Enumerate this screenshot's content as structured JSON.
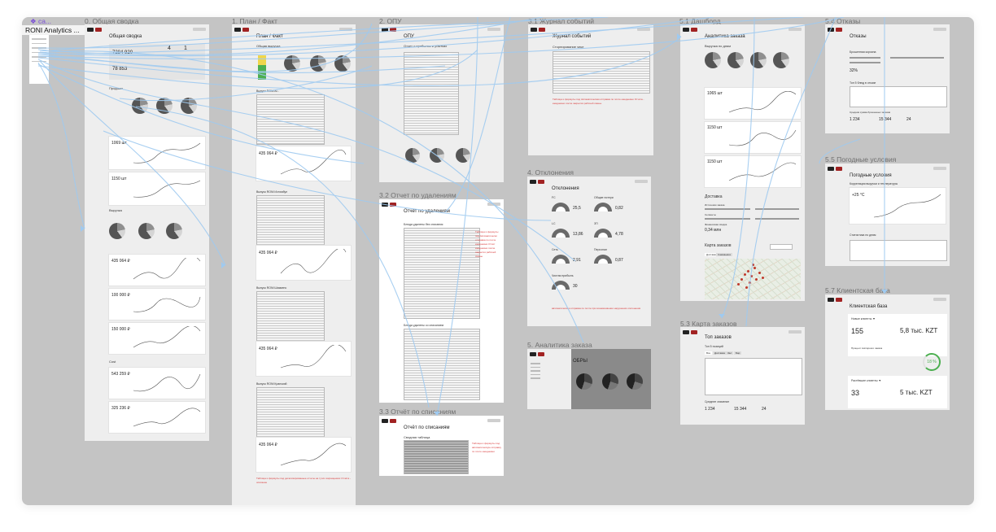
{
  "colors": {
    "canvas": "#c4c4c4",
    "accent_purple": "#7b4fd6",
    "connector_blue": "#9fcaf0",
    "note_red": "#d83a3a",
    "positive_green": "#4caf50",
    "brand_red": "#a12222"
  },
  "page": {
    "badge": "❖ ca...",
    "badge_icon": "component-icon",
    "tab_title": "RONI Analytics ...",
    "tab_icon": "play-icon"
  },
  "frames": {
    "svodka": {
      "label": "0. Общая сводка",
      "title": "Общая сводка",
      "kpi_main": "7284 920",
      "kpi_b": "4",
      "kpi_c": "1",
      "kpi_d": "78 853",
      "sections": [
        "Продажи",
        "Выручка",
        "Cost"
      ],
      "values": [
        "1069 шт",
        "1150 шт",
        "435 064 ₽",
        "100 000 ₽",
        "150 000 ₽",
        "543 259 ₽",
        "325 236 ₽"
      ]
    },
    "planfact": {
      "label": "1. План / Факт",
      "title": "План / Факт",
      "section": "Общая выручка",
      "blocks": [
        "Выпуск RONI Al...",
        "Выпуск RONI Истомбул",
        "Выпуск RONI Шимкенс",
        "Выпуск RONI Кранский"
      ],
      "values": [
        "435 064 ₽",
        "435 064 ₽",
        "435 064 ₽",
        "435 064 ₽"
      ],
      "note": "Таблица и формулы под детализированные отчеты на тугих сокращениях Отчёта - описание"
    },
    "opu": {
      "label": "2. ОПУ",
      "title": "ОПУ",
      "section": "Отчет о прибылях и убытках"
    },
    "udaleniya": {
      "label": "3.2 Отчет по удалениям",
      "title": "Отчет по удалениям",
      "s1": "Блюда удалены без списания",
      "s2": "Блюда удалены со списанием",
      "note": "Таблица и формулы под Автоматически отправка по почте ежедневно Отчёт ежедневно после закрытия рабочей смены"
    },
    "spisaniya": {
      "label": "3.3 Отчёт по списаниям",
      "title": "Отчёт по списаниям",
      "section": "Сводная таблица",
      "note": "Таблица и формулы под автоматическую отправку по почте ежедневно"
    },
    "zhurnal": {
      "label": "3.1 Журнал событий",
      "title": "Журнал событий",
      "section": "Сторнирование чеке",
      "note": "Таблица и формулы под Автоматическая отправка по почте ежедневно Отчёта - ежедневно после закрытия рабочей смены"
    },
    "otkloneniya": {
      "label": "4. Отклонения",
      "title": "Отклонения",
      "gauges": [
        {
          "label": "FC",
          "value": "25,5"
        },
        {
          "label": "Общие потери",
          "value": "0,82"
        },
        {
          "label": "LC",
          "value": "13,86"
        },
        {
          "label": "ЗП",
          "value": "4,78"
        },
        {
          "label": "Сеть",
          "value": "2,91"
        },
        {
          "label": "Персонал",
          "value": "0,87"
        },
        {
          "label": "Чистая прибыль",
          "value": "30"
        }
      ],
      "note": "автоматическая отправка по почте при возникновении нарушения отклонения"
    },
    "analitika": {
      "label": "5. Аналитика заказа",
      "title": "ОБРЫ"
    },
    "dashbord": {
      "label": "5.1 Дашборд",
      "title": "Аналитика заказа",
      "section": "Выручка по дням",
      "values": [
        "1065 шт",
        "1150 шт",
        "1150 шт"
      ],
      "delivery_title": "Доставка",
      "delivery_fields": [
        "Источники заказа",
        "Сегменты",
        "Финансовая сводка"
      ],
      "delivery_value": "0,34 млн",
      "map_title": "Карта заказов",
      "map_tabs": [
        "Доставка",
        "Самовывоз"
      ]
    },
    "karta": {
      "label": "5.3 Карта заказов",
      "title": "Топ заказов",
      "section": "Топ 5 позиций",
      "tabs": [
        "Все",
        "Доставка",
        "Зал",
        "Бар"
      ],
      "avg_label": "Среднее значение",
      "avg": [
        "1 234",
        "15 344",
        "24"
      ]
    },
    "otkazy": {
      "label": "5.4 Отказы",
      "title": "Отказы",
      "section": "Брошенная корзина",
      "value": "32%",
      "top5": "Топ 5 блюд в отказе",
      "avg_label": "Средняя сумма брошенных заказов",
      "avg": [
        "1 234",
        "15 344",
        "24"
      ]
    },
    "pogoda": {
      "label": "5.5 Погодные условия",
      "title": "Погодные условия",
      "section": "Корреляция выручки и температуры",
      "temp": "+25 °C",
      "stats": "Статистика по дням"
    },
    "klient": {
      "label": "5.7 Клиентская база",
      "title": "Клиентская база",
      "new_title": "Новые клиенты ▼",
      "new_count": "155",
      "new_sum": "5,8 тыс. KZT",
      "pct_title": "Процент повторного заказа",
      "pct": "18 %",
      "lost_title": "Растёвшие клиенты ▼",
      "lost_count": "33",
      "lost_sum": "5 тыс. KZT"
    }
  }
}
